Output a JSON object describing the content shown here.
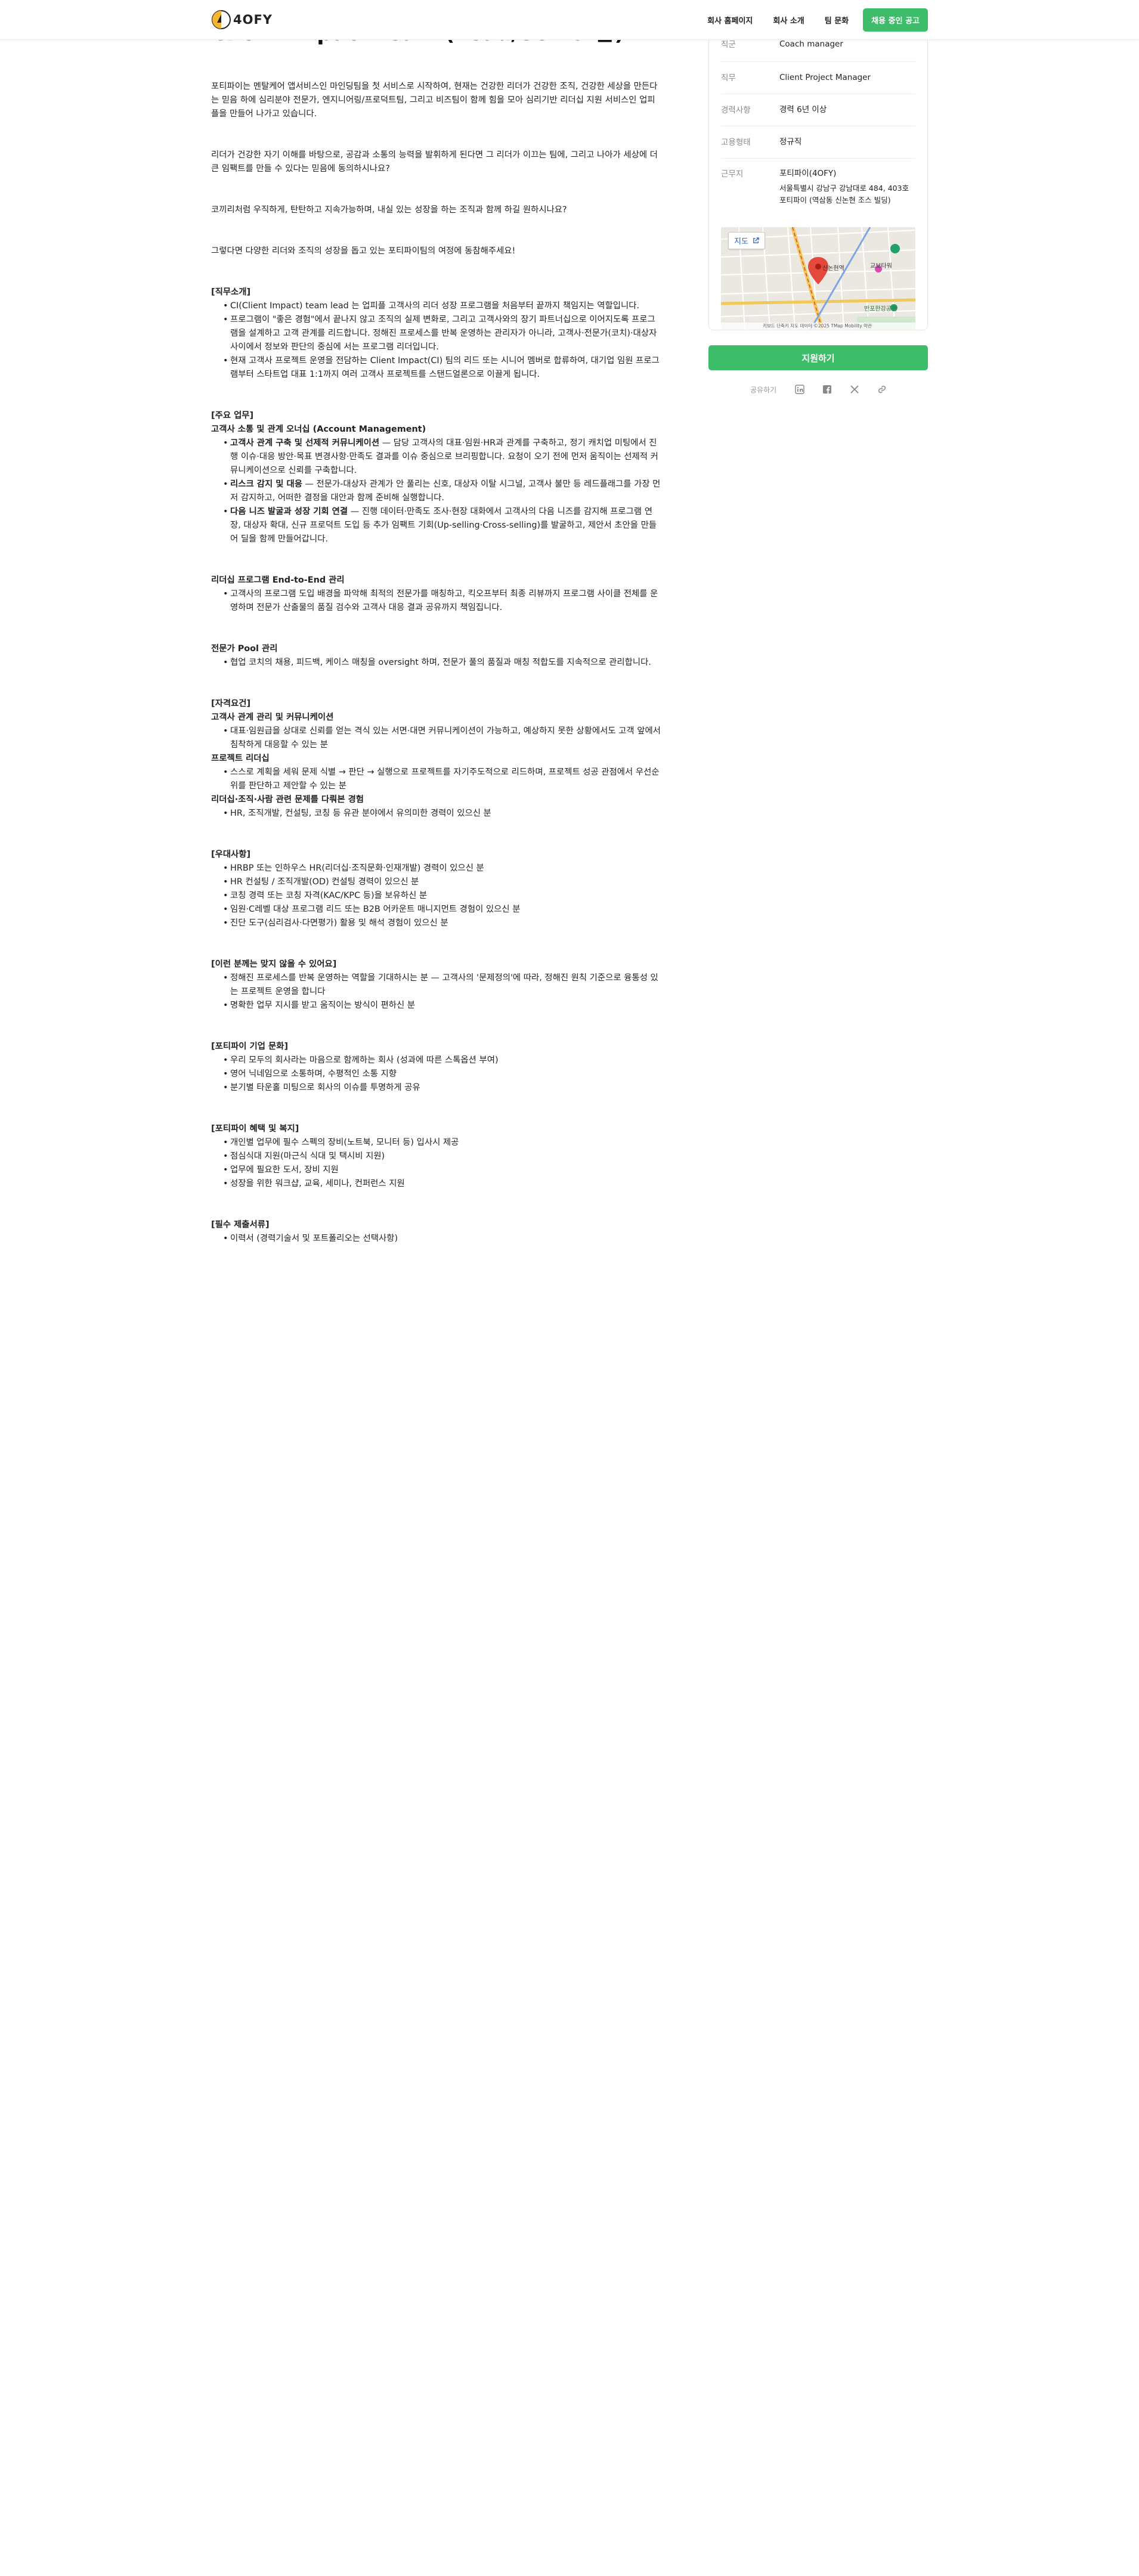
{
  "header": {
    "logo_text": "4OFY",
    "nav": [
      "회사 홈페이지",
      "회사 소개",
      "팀 문화"
    ],
    "cta": "채용 중인 공고"
  },
  "job": {
    "title": "Client Impact Team (Lead/Senior급)",
    "intro": [
      "포티파이는 멘탈케어 앱서비스인 마인딩팀을 첫 서비스로 시작하여, 현재는 건강한 리더가 건강한 조직, 건강한 세상을 만든다는 믿음 하에 심리분야 전문가, 엔지니어링/프로덕트팀, 그리고 비즈팀이 함께 힘을 모아 심리기반 리더십 지원 서비스인 업피플을 만들어 나가고 있습니다.",
      "리더가 건강한 자기 이해를 바탕으로, 공감과 소통의 능력을 발휘하게 된다면 그 리더가 이끄는 팀에, 그리고 나아가 세상에 더 큰 임팩트를 만들 수 있다는 믿음에 동의하시나요?",
      "코끼리처럼 우직하게, 탄탄하고 지속가능하며, 내실 있는 성장을 하는 조직과 함께 하길 원하시나요?",
      "그렇다면 다양한 리더와 조직의 성장을 돕고 있는 포티파이팀의 여정에 동참해주세요!"
    ],
    "role_intro": {
      "title": "[직무소개]",
      "items": [
        "CI(Client Impact) team lead 는 업피플 고객사의 리더 성장 프로그램을 처음부터 끝까지 책임지는 역할입니다.",
        "프로그램이 \"좋은 경험\"에서 끝나지 않고 조직의 실제 변화로, 그리고 고객사와의 장기 파트너십으로 이어지도록 프로그램을 설계하고 고객 관계를 리드합니다. 정해진 프로세스를 반복 운영하는 관리자가 아니라, 고객사·전문가(코치)·대상자 사이에서 정보와 판단의 중심에 서는 프로그램 리더입니다.",
        "현재 고객사 프로젝트 운영을 전담하는 Client Impact(CI) 팀의 리드 또는 시니어 멤버로 합류하여, 대기업 임원 프로그램부터 스타트업 대표 1:1까지 여러 고객사 프로젝트를 스탠드얼론으로 이끌게 됩니다."
      ]
    },
    "main_tasks": {
      "title": "[주요 업무]",
      "sections": [
        {
          "title": "고객사 소통 및 관계 오너십 (Account Management)",
          "items": [
            {
              "bold": "고객사 관계 구축 및 선제적 커뮤니케이션",
              "text": " — 담당 고객사의 대표·임원·HR과 관계를 구축하고, 정기 캐치업 미팅에서 진행 이슈·대응 방안·목표 변경사항·만족도 결과를 이슈 중심으로 브리핑합니다. 요청이 오기 전에 먼저 움직이는 선제적 커뮤니케이션으로 신뢰를 구축합니다."
            },
            {
              "bold": "리스크 감지 및 대응",
              "text": " — 전문가-대상자 관계가 안 풀리는 신호, 대상자 이탈 시그널, 고객사 불만 등 레드플래그를 가장 먼저 감지하고, 어떠한 결정을 대안과 함께 준비해 실행합니다."
            },
            {
              "bold": "다음 니즈 발굴과 성장 기회 연결",
              "text": " — 진행 데이터·만족도 조사·현장 대화에서 고객사의 다음 니즈를 감지해 프로그램 연장, 대상자 확대, 신규 프로덕트 도입 등 추가 임팩트 기회(Up-selling·Cross-selling)를 발굴하고, 제안서 초안을 만들어 딜을 함께 만들어갑니다."
            }
          ]
        },
        {
          "title": "리더십 프로그램 End-to-End 관리",
          "items": [
            {
              "bold": "",
              "text": "고객사의 프로그램 도입 배경을 파악해 최적의 전문가를 매칭하고, 킥오프부터 최종 리뷰까지 프로그램 사이클 전체를 운영하며 전문가 산출물의 품질 검수와 고객사 대응 결과 공유까지 책임집니다."
            }
          ]
        },
        {
          "title": "전문가 Pool 관리",
          "items": [
            {
              "bold": "",
              "text": "협업 코치의 채용, 피드백, 케이스 매칭을 oversight 하며, 전문가 풀의 품질과 매칭 적합도를 지속적으로 관리합니다."
            }
          ]
        }
      ]
    },
    "qualifications": {
      "title": "[자격요건]",
      "sections": [
        {
          "title": "고객사 관계 관리 및 커뮤니케이션",
          "items": [
            "대표·임원급을 상대로 신뢰를 얻는 격식 있는 서면·대면 커뮤니케이션이 가능하고, 예상하지 못한 상황에서도 고객 앞에서 침착하게 대응할 수 있는 분"
          ]
        },
        {
          "title": "프로젝트 리더십",
          "items": [
            "스스로 계획을 세워 문제 식별 → 판단 → 실행으로 프로젝트를 자기주도적으로 리드하며, 프로젝트 성공 관점에서 우선순위를 판단하고 제안할 수 있는 분"
          ]
        },
        {
          "title": "리더십·조직·사람 관련 문제를 다뤄본 경험",
          "items": [
            "HR, 조직개발, 컨설팅, 코칭 등 유관 분야에서 유의미한 경력이 있으신 분"
          ]
        }
      ]
    },
    "preferred": {
      "title": "[우대사항]",
      "items": [
        "HRBP 또는 인하우스 HR(리더십·조직문화·인재개발) 경력이 있으신 분",
        "HR 컨설팅 / 조직개발(OD) 컨설팅 경력이 있으신 분",
        "코칭 경력 또는 코칭 자격(KAC/KPC 등)을 보유하신 분",
        "임원·C레벨 대상 프로그램 리드 또는 B2B 어카운트 매니지먼트 경험이 있으신 분",
        "진단 도구(심리검사·다면평가) 활용 및 해석 경험이 있으신 분"
      ]
    },
    "not_fit": {
      "title": "[이런 분께는 맞지 않을 수 있어요]",
      "items": [
        "정해진 프로세스를 반복 운영하는 역할을 기대하시는 분 — 고객사의 '문제정의'에 따라, 정해진 원칙 기준으로 융통성 있는 프로젝트 운영을 합니다",
        "명확한 업무 지시를 받고 움직이는 방식이 편하신 분"
      ]
    },
    "culture": {
      "title": "[포티파이 기업 문화]",
      "items": [
        "우리 모두의 회사라는 마음으로 함께하는 회사 (성과에 따른 스톡옵션 부여)",
        "영어 닉네임으로 소통하며, 수평적인 소통 지향",
        "분기별 타운홀 미팅으로 회사의 이슈를 투명하게 공유"
      ]
    },
    "benefits": {
      "title": "[포티파이 혜택 및 복지]",
      "items": [
        "개인별 업무에 필수 스펙의 장비(노트북, 모니터 등) 입사시 제공",
        "점심식대 지원(마근식 식대 및 택시비 지원)",
        "업무에 필요한 도서, 장비 지원",
        "성장을 위한 워크샵, 교육, 세미나, 컨퍼런스 지원"
      ]
    },
    "documents": {
      "title": "[필수 제출서류]",
      "items": [
        "이력서 (경력기술서 및 포트폴리오는 선택사항)"
      ]
    }
  },
  "sidebar": {
    "rows": [
      {
        "label": "직군",
        "value": "Coach manager"
      },
      {
        "label": "직무",
        "value": "Client Project Manager"
      },
      {
        "label": "경력사항",
        "value": "경력 6년 이상"
      },
      {
        "label": "고용형태",
        "value": "정규직"
      }
    ],
    "location": {
      "label": "근무지",
      "name": "포티파이(4OFY)",
      "address": "서울특별시 강남구 강남대로 484, 403호 포티파이 (역삼동 신논현 조스 빌딩)"
    },
    "map": {
      "button": "지도",
      "labels": [
        "신논현역",
        "교보타워",
        "반포한강공원"
      ],
      "attribution": "키보드 단축키  지도 데이터 ©2025 TMap Mobility  약관"
    },
    "apply": "지원하기",
    "share_label": "공유하기",
    "share_icons": [
      "linkedin-icon",
      "facebook-icon",
      "x-icon",
      "link-icon"
    ]
  },
  "colors": {
    "accent": "#3dbd6a",
    "text": "#1f1f1f",
    "muted": "#8a8a8a"
  }
}
